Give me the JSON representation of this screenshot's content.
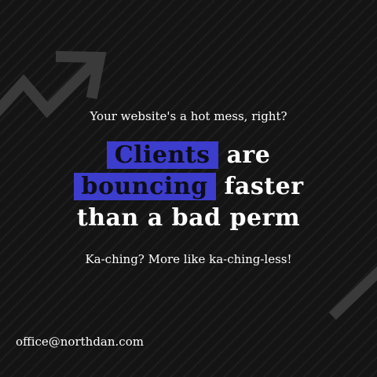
{
  "top_tagline": "Your website's a hot mess, right?",
  "headline": {
    "line1_highlight": "Clients",
    "line1_rest": "are",
    "line2_highlight": "bouncing",
    "line2_rest": "faster",
    "line3": "than a bad perm"
  },
  "bottom_tagline": "Ka-ching? More like ka-ching-less!",
  "email": "office@northdan.com",
  "colors": {
    "background": "#141414",
    "highlight": "#3c3ccd",
    "text": "#ffffff",
    "decoration": "#3a3a3a"
  },
  "icons": [
    "trend-arrow-icon",
    "trend-arrow-icon"
  ]
}
